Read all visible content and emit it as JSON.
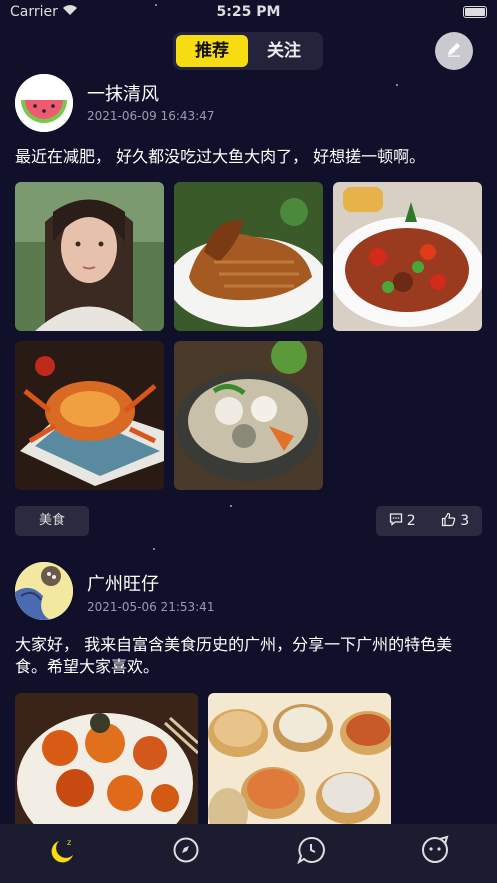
{
  "status": {
    "carrier": "Carrier",
    "time": "5:25 PM"
  },
  "tabs": [
    {
      "label": "推荐",
      "active": true
    },
    {
      "label": "关注",
      "active": false
    }
  ],
  "posts": [
    {
      "username": "一抹清风",
      "time": "2021-06-09 16:43:47",
      "text": "最近在减肥， 好久都没吃过大鱼大肉了， 好想搓一顿啊。",
      "tag": "美食",
      "comments": "2",
      "likes": "3",
      "images": [
        "portrait-photo",
        "roast-duck",
        "stir-fried-chicken",
        "crab-dish",
        "soup-pot"
      ]
    },
    {
      "username": "广州旺仔",
      "time": "2021-05-06 21:53:41",
      "text": "大家好， 我来自富含美食历史的广州，分享一下广州的特色美食。希望大家喜欢。",
      "images": [
        "braised-radish",
        "dim-sum-steamers"
      ]
    }
  ],
  "colors": {
    "accent": "#f7dc13",
    "background": "#10102a",
    "card": "#2a2a40"
  },
  "tabbar": [
    "moon-icon",
    "compass-icon",
    "chat-icon",
    "face-icon"
  ]
}
